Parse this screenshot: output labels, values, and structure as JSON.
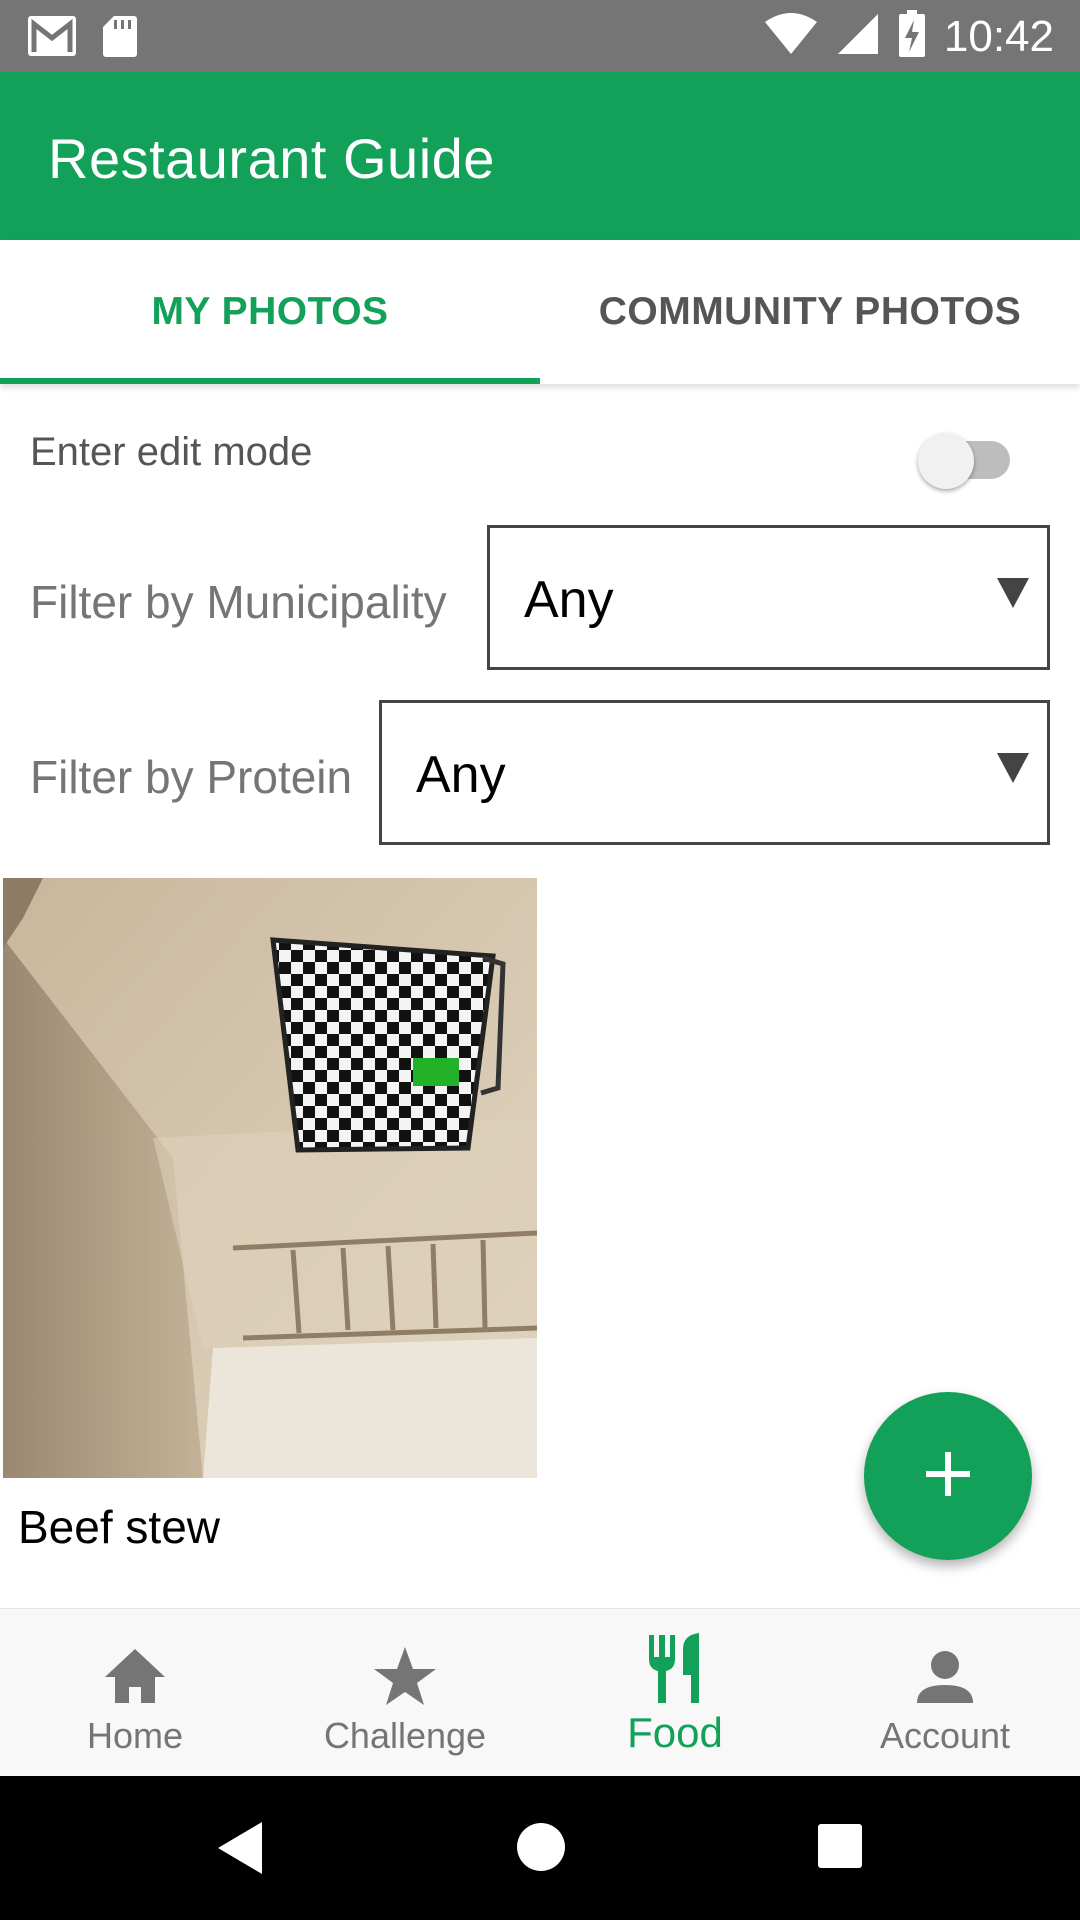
{
  "status_bar": {
    "time": "10:42",
    "icons": [
      "gmail-icon",
      "sd-card-icon",
      "wifi-icon",
      "cell-signal-icon",
      "battery-charging-icon"
    ]
  },
  "app_bar": {
    "title": "Restaurant Guide"
  },
  "tabs": [
    {
      "label": "MY PHOTOS",
      "selected": true
    },
    {
      "label": "COMMUNITY PHOTOS",
      "selected": false
    }
  ],
  "edit_mode": {
    "label": "Enter edit mode",
    "enabled": false
  },
  "filters": {
    "municipality": {
      "label": "Filter by Municipality",
      "value": "Any"
    },
    "protein": {
      "label": "Filter by Protein",
      "value": "Any"
    }
  },
  "photos": [
    {
      "caption": "Beef stew"
    }
  ],
  "bottom_nav": [
    {
      "label": "Home",
      "icon": "home-icon",
      "active": false
    },
    {
      "label": "Challenge",
      "icon": "star-icon",
      "active": false
    },
    {
      "label": "Food",
      "icon": "fork-knife-icon",
      "active": true
    },
    {
      "label": "Account",
      "icon": "person-icon",
      "active": false
    }
  ],
  "colors": {
    "primary": "#13a058",
    "status_bar": "#757575"
  }
}
